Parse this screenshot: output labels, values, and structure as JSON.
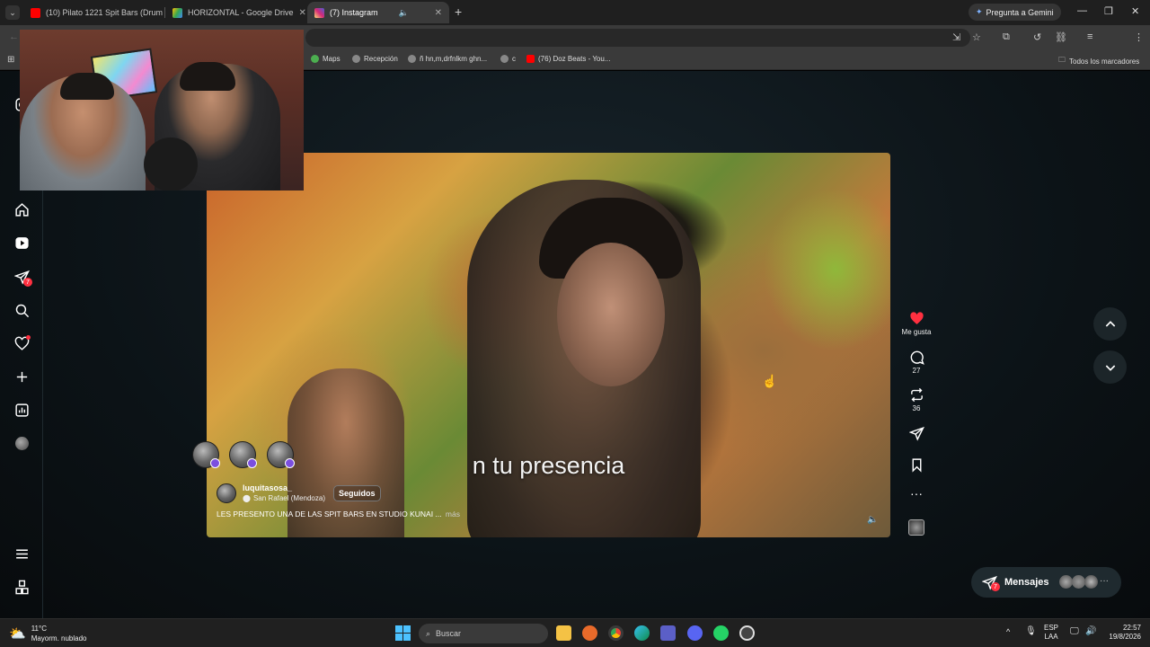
{
  "browser": {
    "tabs": [
      {
        "title": "(10) Pilato 1221 Spit Bars (Drum",
        "favicon": "youtube-icon",
        "color": "#ff0000"
      },
      {
        "title": "HORIZONTAL - Google Drive",
        "favicon": "google-drive-icon",
        "color": "#34a853"
      },
      {
        "title": "(7) Instagram",
        "favicon": "instagram-icon",
        "color": "#e1306c"
      }
    ],
    "gemini_label": "Pregunta a Gemini",
    "bookmarks": [
      {
        "label": "Maps"
      },
      {
        "label": "Recepción"
      },
      {
        "label": "ñ hn,m,drfnlkm ghn..."
      },
      {
        "label": "c"
      },
      {
        "label": "(76) Doz Beats - You..."
      }
    ],
    "all_bookmarks_label": "Todos los marcadores"
  },
  "instagram": {
    "nav_badge_count": "7",
    "reel": {
      "subtitle": "n tu presencia",
      "username": "luquitasosa_",
      "location": "San Rafael (Mendoza)",
      "follow_label": "Seguidos",
      "caption": "LES PRESENTO UNA DE LAS SPIT BARS EN STUDIO KUNAI ...",
      "more_label": "más"
    },
    "actions": {
      "like_label": "Me gusta",
      "comments": "27",
      "reposts": "36"
    },
    "messages": {
      "label": "Mensajes",
      "badge": "7"
    },
    "colors": {
      "accent_like": "#ff3040",
      "badge": "#ff3040"
    }
  },
  "taskbar": {
    "weather_temp": "11°C",
    "weather_desc": "Mayorm. nublado",
    "search_placeholder": "Buscar",
    "lang_top": "ESP",
    "lang_bottom": "LAA",
    "time": "22:57",
    "date": "19/8/2026"
  }
}
